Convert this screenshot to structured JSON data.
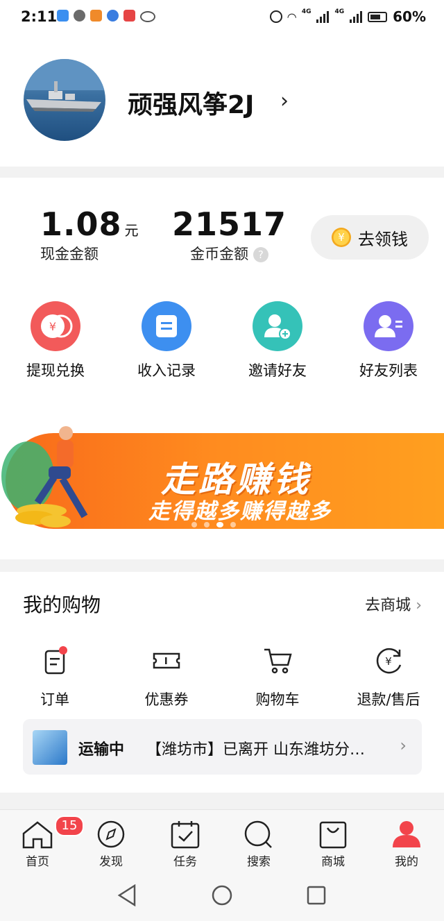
{
  "statusbar": {
    "time": "2:11",
    "battery": "60%",
    "net1": "4G",
    "net2": "4G"
  },
  "profile": {
    "username": "顽强风筝2J",
    "chevron": "›"
  },
  "wallet": {
    "cash_value": "1.08",
    "cash_unit": "元",
    "cash_label": "现金金额",
    "coin_value": "21517",
    "coin_label": "金币金额",
    "help": "?",
    "get_money_label": "去领钱",
    "coin_symbol": "¥"
  },
  "quick_actions": [
    {
      "label": "提现兑换",
      "icon": "withdraw-icon",
      "color": "#f25a5a"
    },
    {
      "label": "收入记录",
      "icon": "income-record-icon",
      "color": "#3d8ff0"
    },
    {
      "label": "邀请好友",
      "icon": "invite-friend-icon",
      "color": "#35c2b8"
    },
    {
      "label": "好友列表",
      "icon": "friend-list-icon",
      "color": "#7b6cf0"
    }
  ],
  "banner": {
    "title": "走路赚钱",
    "subtitle": "走得越多赚得越多"
  },
  "shopping": {
    "title": "我的购物",
    "go_mall": "去商城",
    "items": [
      {
        "label": "订单",
        "icon": "order-icon"
      },
      {
        "label": "优惠券",
        "icon": "coupon-icon"
      },
      {
        "label": "购物车",
        "icon": "cart-icon"
      },
      {
        "label": "退款/售后",
        "icon": "refund-icon"
      }
    ],
    "tracking": {
      "status": "运输中",
      "message": "【潍坊市】已离开 山东潍坊分…"
    }
  },
  "tabbar": {
    "badge": "15",
    "tabs": [
      {
        "label": "首页",
        "icon": "home-icon"
      },
      {
        "label": "发现",
        "icon": "compass-icon"
      },
      {
        "label": "任务",
        "icon": "task-icon"
      },
      {
        "label": "搜索",
        "icon": "search-icon"
      },
      {
        "label": "商城",
        "icon": "mall-bag-icon"
      },
      {
        "label": "我的",
        "icon": "user-icon",
        "active": true
      }
    ]
  },
  "colors": {
    "accent": "#f2444b",
    "banner": "#ff8b1f"
  }
}
